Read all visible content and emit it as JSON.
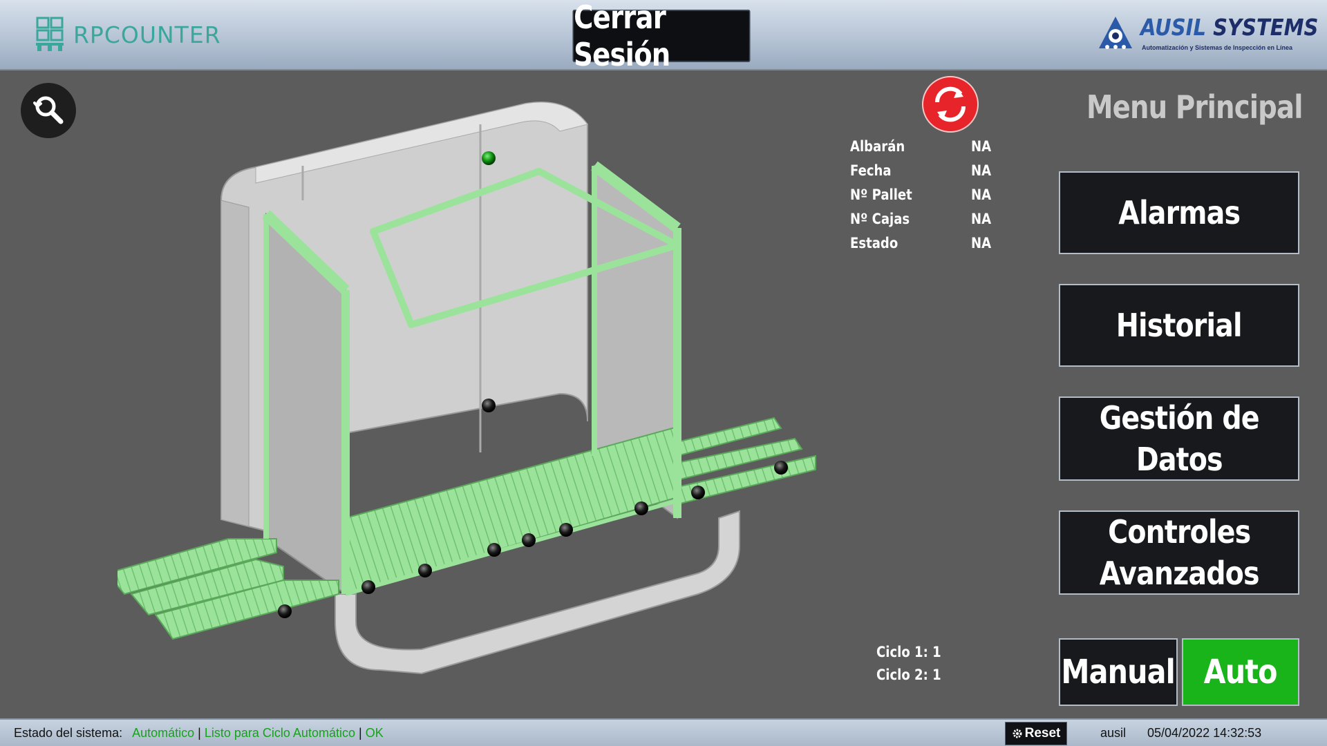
{
  "header": {
    "app_logo_text": "RPCOUNTER",
    "logout_label": "Cerrar Sesión",
    "company_name_part1": "AUSIL",
    "company_name_part2": "SYSTEMS",
    "company_tagline": "Automatización y Sistemas de Inspección en Línea"
  },
  "info": {
    "fields": [
      {
        "label": "Albarán",
        "value": "NA"
      },
      {
        "label": "Fecha",
        "value": "NA"
      },
      {
        "label": "Nº Pallet",
        "value": "NA"
      },
      {
        "label": "Nº Cajas",
        "value": "NA"
      },
      {
        "label": "Estado",
        "value": "NA"
      }
    ]
  },
  "menu": {
    "title": "Menu Principal",
    "buttons": [
      {
        "label": "Alarmas"
      },
      {
        "label": "Historial"
      },
      {
        "label": "Gestión de\nDatos"
      },
      {
        "label": "Controles\nAvanzados"
      }
    ],
    "manual_label": "Manual",
    "auto_label": "Auto"
  },
  "cycles": [
    {
      "label": "Ciclo 1:",
      "value": "1"
    },
    {
      "label": "Ciclo 2:",
      "value": "1"
    }
  ],
  "status": {
    "prefix": "Estado del sistema:",
    "mode": "Automático",
    "sep1": "|",
    "message": "Listo para Ciclo Automático",
    "sep2": "|",
    "result": "OK",
    "reset_label": "Reset",
    "user": "ausil",
    "datetime": "05/04/2022 14:32:53"
  },
  "colors": {
    "auto_active": "#18b41a",
    "machine_frame": "#9be39b",
    "reset_icon": "#e8242b",
    "status_ok": "#16a21a"
  },
  "icons": {
    "search": "search-refresh-icon",
    "reset": "rotate-arrows-icon",
    "reset_small": "gear-icon"
  }
}
